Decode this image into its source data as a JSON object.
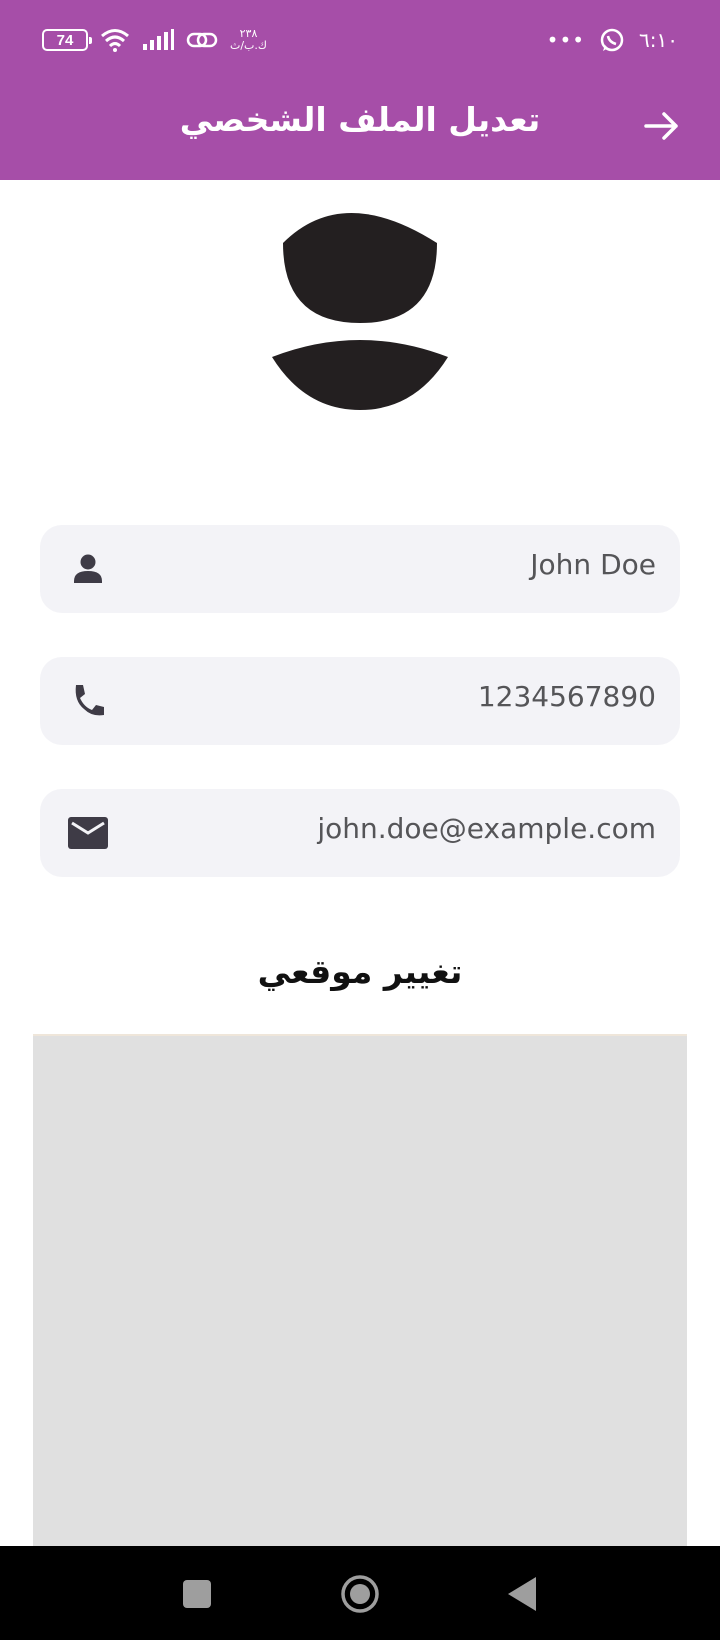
{
  "status_bar": {
    "battery": "74",
    "net_speed_value": "٢٣٨",
    "net_speed_unit": "ك.ب/ث",
    "time": "٦:١٠",
    "more": "•••"
  },
  "header": {
    "title": "تعديل الملف الشخصي"
  },
  "profile": {
    "name": "John Doe",
    "phone": "1234567890",
    "email": "john.doe@example.com"
  },
  "location": {
    "title": "تغيير موقعي"
  },
  "colors": {
    "app_bar": "#a64ea8",
    "field_background": "#f3f3f7",
    "map_placeholder": "#e0e0e0"
  }
}
